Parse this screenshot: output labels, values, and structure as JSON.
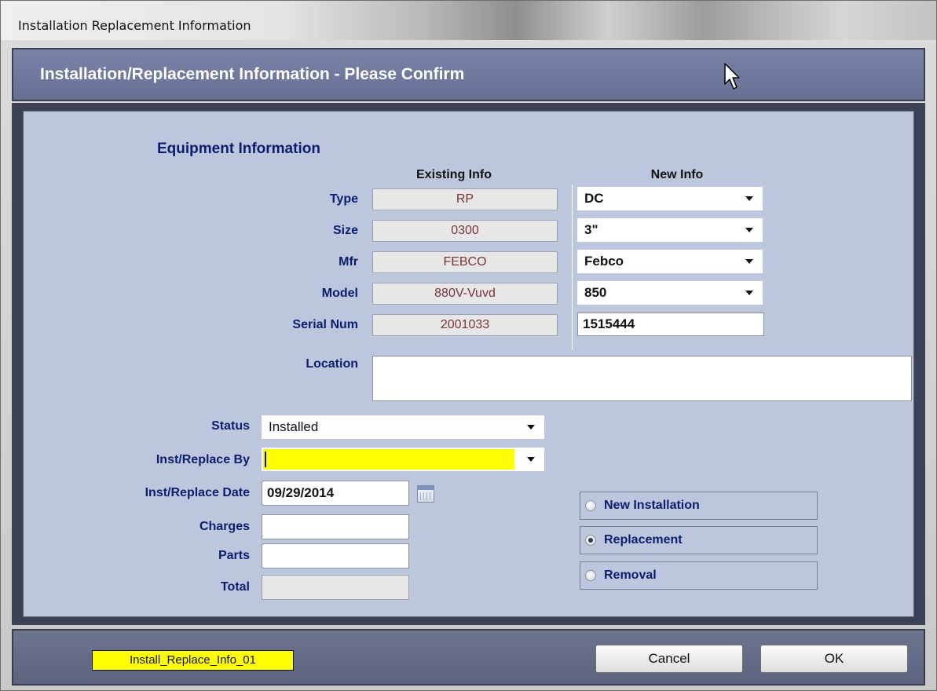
{
  "window": {
    "title": "Installation Replacement Information"
  },
  "header": {
    "title": "Installation/Replacement Information - Please Confirm"
  },
  "equipment": {
    "section_title": "Equipment Information",
    "existing_header": "Existing Info",
    "new_header": "New Info",
    "rows": [
      {
        "label": "Type",
        "existing": "RP",
        "new": "DC"
      },
      {
        "label": "Size",
        "existing": "0300",
        "new": "3\""
      },
      {
        "label": "Mfr",
        "existing": "FEBCO",
        "new": "Febco"
      },
      {
        "label": "Model",
        "existing": "880V-Vuvd",
        "new": "850"
      },
      {
        "label": "Serial Num",
        "existing": "2001033",
        "new": "1515444"
      }
    ],
    "location_label": "Location",
    "location_value": ""
  },
  "form": {
    "status_label": "Status",
    "status_value": "Installed",
    "inst_by_label": "Inst/Replace By",
    "inst_by_value": "",
    "inst_date_label": "Inst/Replace Date",
    "inst_date_value": "09/29/2014",
    "charges_label": "Charges",
    "charges_value": "",
    "parts_label": "Parts",
    "parts_value": "",
    "total_label": "Total",
    "total_value": ""
  },
  "options": {
    "new_installation": "New Installation",
    "replacement": "Replacement",
    "removal": "Removal",
    "selected": "Replacement"
  },
  "footer": {
    "screen_id": "Install_Replace_Info_01",
    "cancel_label": "Cancel",
    "ok_label": "OK"
  },
  "colors": {
    "header_band": "#7b83a8",
    "panel_bg": "#bcc6dd",
    "label_text": "#0c1d6e",
    "highlight_field": "#ffff00"
  }
}
